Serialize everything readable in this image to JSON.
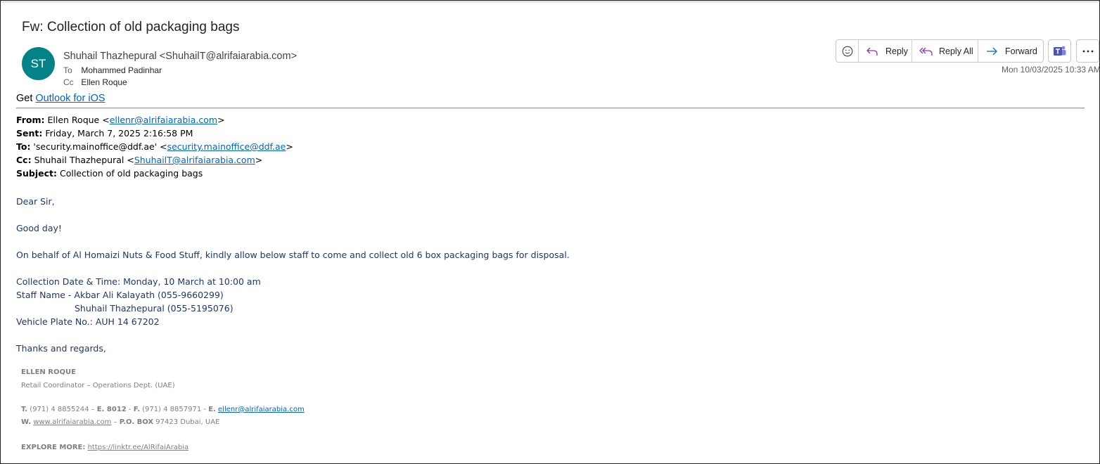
{
  "email": {
    "subject": "Fw: Collection of old packaging bags",
    "avatar_initials": "ST",
    "avatar_color": "#038387",
    "sender": "Shuhail Thazhepural <ShuhailT@alrifaiarabia.com>",
    "to_label": "To",
    "to_value": "Mohammed Padinhar",
    "cc_label": "Cc",
    "cc_value": "Ellen Roque",
    "date": "Mon 10/03/2025 10:33 AM"
  },
  "actions": {
    "emoji_icon": "smiley-icon",
    "reply": "Reply",
    "reply_all": "Reply All",
    "forward": "Forward",
    "teams_icon": "teams-icon",
    "more_icon": "more-icon"
  },
  "get_line": {
    "prefix": "Get ",
    "link": "Outlook for iOS"
  },
  "forwarded": {
    "from_label": "From:",
    "from_name": " Ellen Roque <",
    "from_email": "ellenr@alrifaiarabia.com",
    "from_end": ">",
    "sent_label": "Sent:",
    "sent_value": " Friday, March 7, 2025 2:16:58 PM",
    "to_label": "To:",
    "to_name": " 'security.mainoffice@ddf.ae' <",
    "to_email": "security.mainoffice@ddf.ae",
    "to_end": ">",
    "cc_label": "Cc:",
    "cc_name": " Shuhail Thazhepural <",
    "cc_email": "ShuhailT@alrifaiarabia.com",
    "cc_end": ">",
    "subject_label": "Subject:",
    "subject_value": " Collection of old packaging bags"
  },
  "body": {
    "greeting": "Dear Sir,",
    "good_day": "Good day!",
    "request": "On behalf of Al Homaizi Nuts & Food Stuff, kindly allow below staff to come and collect old 6 box packaging bags for disposal.",
    "collection": "Collection Date & Time:  Monday, 10 March at 10:00 am",
    "staff1": "Staff Name - Akbar Ali Kalayath (055-9660299)",
    "staff2": "Shuhail Thazhepural (055-5195076)",
    "vehicle": "Vehicle Plate No.: AUH 14 67202",
    "closing": "Thanks and regards,"
  },
  "signature": {
    "name": "ELLEN ROQUE",
    "title": "Retail Coordinator – Operations Dept. (UAE)",
    "t_label": "T.",
    "t_value": " (971) 4 8855244 – ",
    "e_label": "E. 8012",
    "f_sep": " - ",
    "f_label": "F.",
    "f_value": " (971) 4 8857971 - ",
    "email_label": "E.",
    "email_value": "ellenr@alrifaiarabia.com",
    "w_label": "W.",
    "website": "www.alrifaiarabia.com",
    "po_sep": " – ",
    "po_label": "P.O. BOX",
    "po_value": " 97423 Dubai, UAE",
    "explore_label": "EXPLORE MORE:",
    "explore_link": "https://linktr.ee/AlRifaiArabia"
  }
}
